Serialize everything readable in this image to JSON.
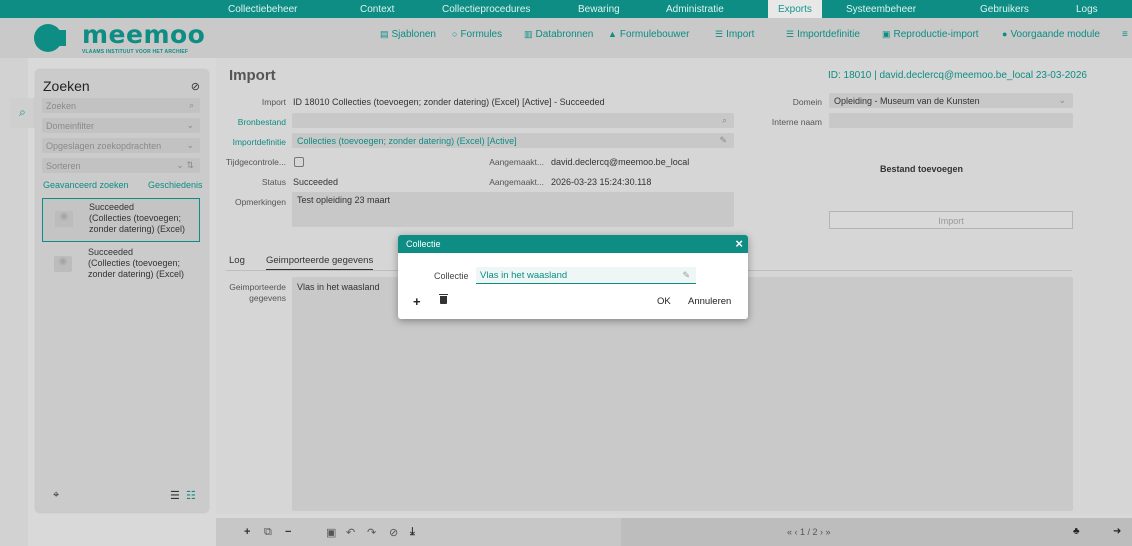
{
  "topnav": {
    "items": [
      "Collectiebeheer",
      "Context",
      "Collectieprocedures",
      "Bewaring",
      "Administratie",
      "Exports",
      "Systeembeheer",
      "Gebruikers",
      "Logs"
    ],
    "active": "Exports"
  },
  "brand": {
    "name": "meemoo",
    "subtitle": "VLAAMS INSTITUUT VOOR HET ARCHIEF"
  },
  "subnav": {
    "items": [
      {
        "label": "Sjablonen",
        "icon": "template-icon"
      },
      {
        "label": "Formules",
        "icon": "circle-icon"
      },
      {
        "label": "Databronnen",
        "icon": "chart-icon"
      },
      {
        "label": "Formulebouwer",
        "icon": "graduation-cap-icon"
      },
      {
        "label": "Import",
        "icon": "list-icon"
      },
      {
        "label": "Importdefinitie",
        "icon": "list-icon"
      },
      {
        "label": "Reproductie-import",
        "icon": "image-icon"
      },
      {
        "label": "Voorgaande module",
        "icon": "circle-arrow-icon"
      }
    ],
    "active": "Import"
  },
  "search_panel": {
    "title": "Zoeken",
    "search_placeholder": "Zoeken",
    "domain_filter": "Domeinfilter",
    "saved_queries": "Opgeslagen zoekopdrachten",
    "sort": "Sorteren",
    "advanced_link": "Geavanceerd zoeken",
    "history_link": "Geschiedenis",
    "results": [
      {
        "text": "Succeeded\n(Collecties (toevoegen;\nzonder datering) (Excel)",
        "selected": true
      },
      {
        "text": "Succeeded\n(Collecties (toevoegen;\nzonder datering) (Excel)",
        "selected": false
      }
    ]
  },
  "main": {
    "heading": "Import",
    "record_id": "ID: 18010 | david.declercq@meemoo.be_local 23-03-2026",
    "labels": {
      "import": "Import",
      "source_file": "Bronbestand",
      "import_definition": "Importdefinitie",
      "time_check": "Tijdgecontrole...",
      "status": "Status",
      "remarks": "Opmerkingen",
      "created_by": "Aangemaakt...",
      "created_on": "Aangemaakt...",
      "domain": "Domein",
      "internal_name": "Interne naam"
    },
    "values": {
      "import": "ID 18010 Collecties (toevoegen; zonder datering) (Excel) [Active] - Succeeded",
      "import_definition": "Collecties (toevoegen; zonder datering) (Excel) [Active]",
      "status": "Succeeded",
      "remarks": "Test opleiding 23 maart",
      "created_by": "david.declercq@meemoo.be_local",
      "created_on": "2026-03-23 15:24:30.118",
      "domain": "Opleiding - Museum van de Kunsten"
    },
    "add_file_label": "Bestand toevoegen",
    "import_button": "Import",
    "tabs": [
      "Log",
      "Geimporteerde gegevens"
    ],
    "active_tab": "Geimporteerde gegevens",
    "imported_label": "Geimporteerde\ngegevens",
    "imported_value": "Vlas in het waasland"
  },
  "modal": {
    "title": "Collectie",
    "field_label": "Collectie",
    "field_value": "Vlas in het waasland",
    "ok": "OK",
    "cancel": "Annuleren"
  },
  "pager": {
    "text": "«  ‹  1 / 2  ›  »"
  },
  "colors": {
    "accent": "#0d8d83",
    "overlay_bg": "#d6d6d6"
  }
}
